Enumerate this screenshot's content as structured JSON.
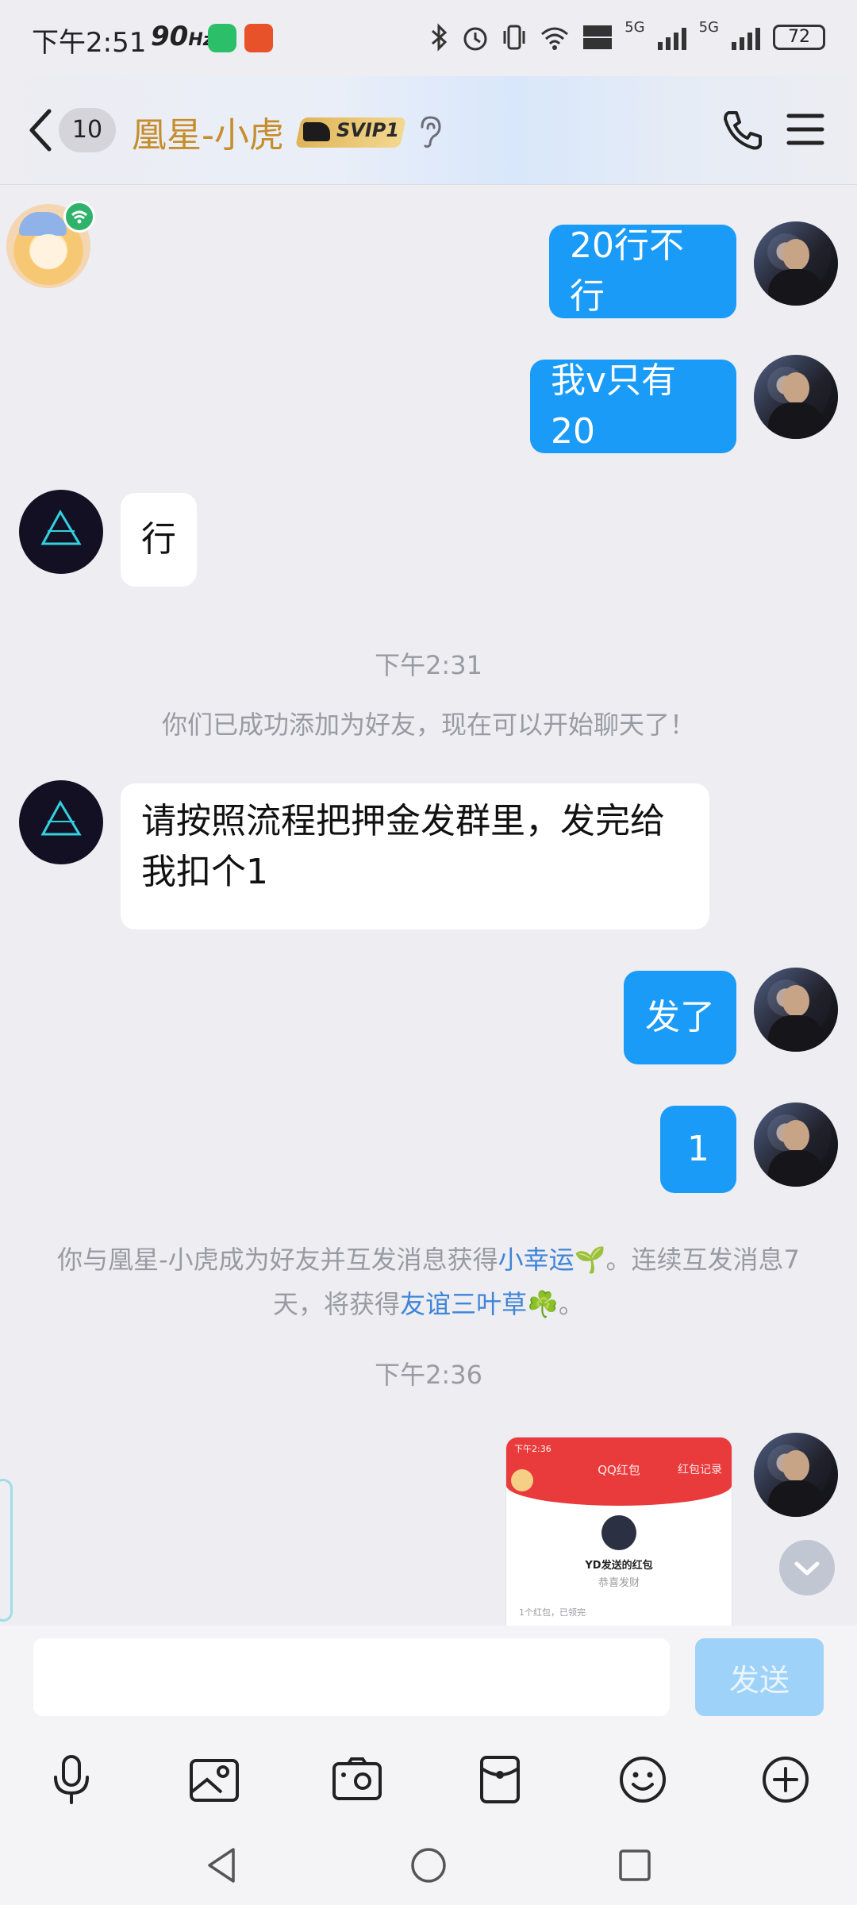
{
  "status_bar": {
    "time": "下午2:51",
    "refresh_rate": "90",
    "refresh_unit": "Hz",
    "battery": "72",
    "network_1": "5G",
    "network_2": "5G"
  },
  "header": {
    "unread_count": "10",
    "contact_name": "凰星-小虎",
    "vip_badge": "SVIP1"
  },
  "messages": {
    "m1": "20行不行",
    "m2": "我v只有20",
    "m3": "行",
    "time_1": "下午2:31",
    "system_1": "你们已成功添加为好友，现在可以开始聊天了！",
    "m4_line1": "请按照流程把押金发群里，发完给",
    "m4_line2": "我扣个1",
    "m5": "发了",
    "m6": "1",
    "system_2_part1": "你与凰星-小虎成为好友并互发消息获得",
    "system_2_link1": "小幸运🌱",
    "system_2_part2": "。连续互发消息7",
    "system_2_part3": "天，将获得",
    "system_2_link2": "友谊三叶草☘️",
    "system_2_part4": "。",
    "time_2": "下午2:36"
  },
  "red_packet": {
    "status_text": "下午2:36",
    "title": "QQ红包",
    "record_label": "红包记录",
    "from": "YD发送的红包",
    "wish": "恭喜发财",
    "count": "1个红包，已领完"
  },
  "input": {
    "placeholder": "",
    "value": ""
  },
  "actions": {
    "send_label": "发送"
  },
  "toolbar_icons": [
    "microphone-icon",
    "image-icon",
    "camera-icon",
    "red-packet-icon",
    "emoji-icon",
    "plus-icon"
  ],
  "colors": {
    "self_bubble": "#1a9bf7",
    "other_bubble": "#ffffff",
    "name_gold": "#c68d2c",
    "link_blue": "#3f85d8",
    "send_disabled": "#9fd2f9"
  }
}
